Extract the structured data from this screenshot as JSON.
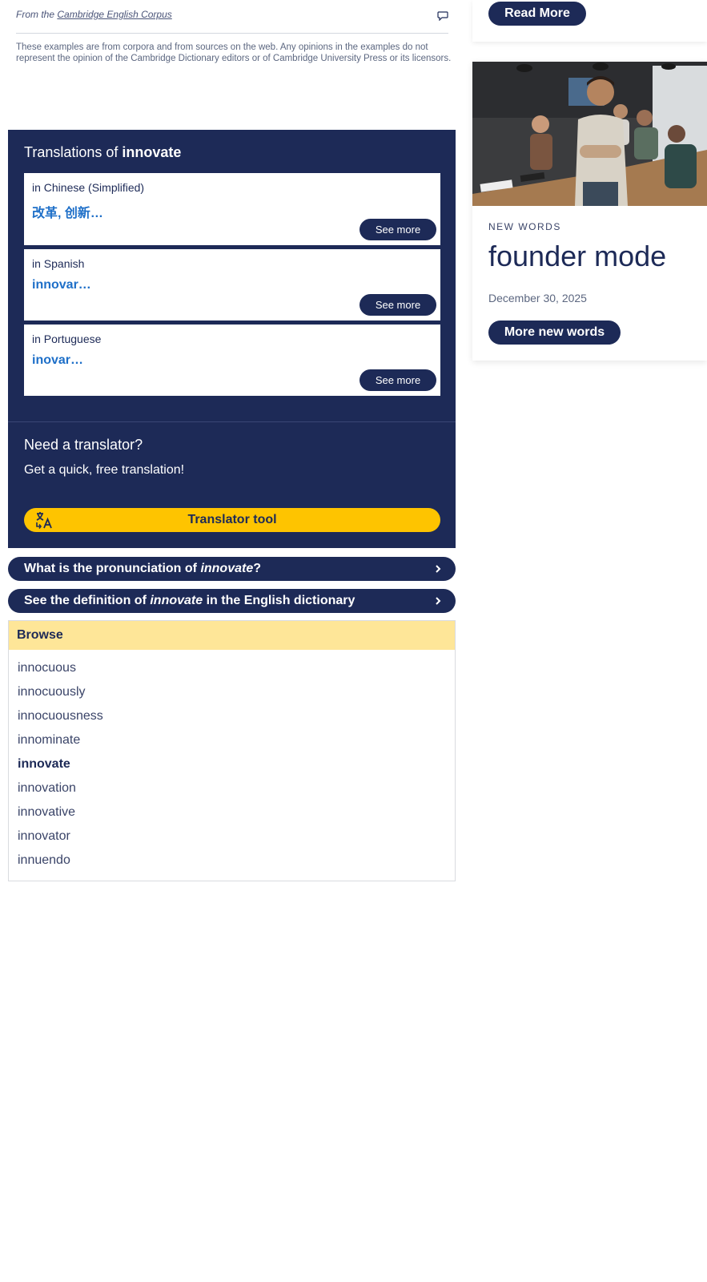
{
  "corpus": {
    "from_prefix": "From the ",
    "source_link": "Cambridge English Corpus",
    "disclaimer": "These examples are from corpora and from sources on the web. Any opinions in the examples do not represent the opinion of the Cambridge Dictionary editors or of Cambridge University Press or its licensors."
  },
  "translations": {
    "heading_prefix": "Translations of ",
    "word": "innovate",
    "items": [
      {
        "lang": "in Chinese (Simplified)",
        "text": "改革, 创新…",
        "button": "See more"
      },
      {
        "lang": "in Spanish",
        "text": "innovar…",
        "button": "See more"
      },
      {
        "lang": "in Portuguese",
        "text": "inovar…",
        "button": "See more"
      }
    ]
  },
  "translator": {
    "title": "Need a translator?",
    "subtitle": "Get a quick, free translation!",
    "button": "Translator tool"
  },
  "links": {
    "pron_prefix": "What is the pronunciation of ",
    "pron_word": "innovate",
    "pron_suffix": "?",
    "def_prefix": "See the definition of ",
    "def_word": "innovate",
    "def_suffix": " in the English dictionary"
  },
  "browse": {
    "title": "Browse",
    "items": [
      "innocuous",
      "innocuously",
      "innocuousness",
      "innominate",
      "innovate",
      "innovation",
      "innovative",
      "innovator",
      "innuendo"
    ],
    "current": "innovate"
  },
  "sidebar": {
    "read_more": "Read More",
    "new_words": {
      "label": "NEW WORDS",
      "title": "founder mode",
      "date": "December 30, 2025",
      "button": "More new words"
    }
  },
  "colors": {
    "navy": "#1d2a57",
    "yellow": "#fec400",
    "light_yellow": "#fee698",
    "link_blue": "#1e6fc8"
  }
}
